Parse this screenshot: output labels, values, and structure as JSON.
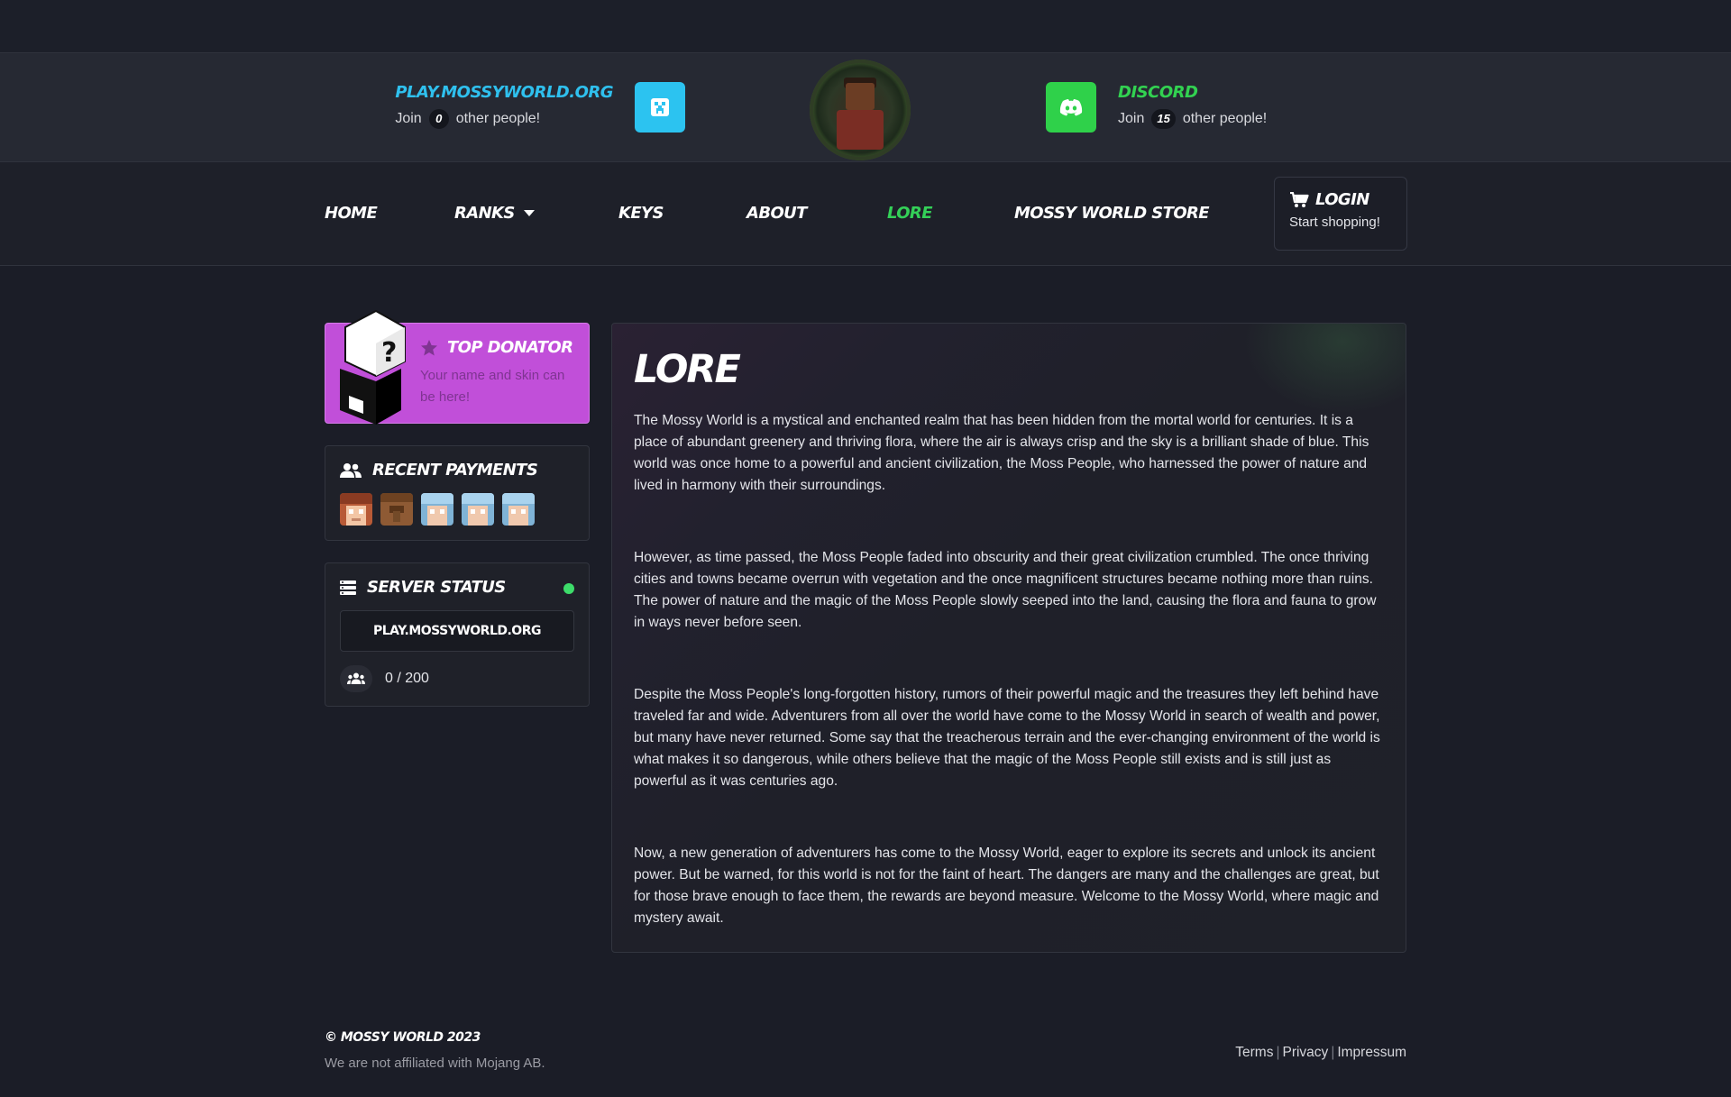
{
  "header": {
    "server_ip": "PLAY.MOSSYWORLD.ORG",
    "join_prefix": "Join",
    "join_suffix": "other people!",
    "server_players_count": "0",
    "discord_label": "DISCORD",
    "discord_members_count": "15"
  },
  "nav": {
    "items": [
      {
        "label": "HOME"
      },
      {
        "label": "RANKS"
      },
      {
        "label": "KEYS"
      },
      {
        "label": "ABOUT"
      },
      {
        "label": "LORE"
      },
      {
        "label": "MOSSY WORLD STORE"
      }
    ],
    "active": "LORE",
    "login_title": "LOGIN",
    "login_sub": "Start shopping!"
  },
  "sidebar": {
    "top_donator": {
      "title": "TOP DONATOR",
      "subtitle": "Your name and skin can be here!"
    },
    "recent_payments": {
      "title": "RECENT PAYMENTS",
      "avatars": [
        "red-hair-skin",
        "brown-villager-skin",
        "blue-hair-skin",
        "blue-hair-skin",
        "blue-hair-skin"
      ]
    },
    "server_status": {
      "title": "SERVER STATUS",
      "ip": "PLAY.MOSSYWORLD.ORG",
      "players": "0 / 200",
      "status_color": "#3ddc6a"
    }
  },
  "main": {
    "title": "LORE",
    "paragraphs": [
      "The Mossy World is a mystical and enchanted realm that has been hidden from the mortal world for centuries. It is a place of abundant greenery and thriving flora, where the air is always crisp and the sky is a brilliant shade of blue. This world was once home to a powerful and ancient civilization, the Moss People, who harnessed the power of nature and lived in harmony with their surroundings.",
      "However, as time passed, the Moss People faded into obscurity and their great civilization crumbled. The once thriving cities and towns became overrun with vegetation and the once magnificent structures became nothing more than ruins. The power of nature and the magic of the Moss People slowly seeped into the land, causing the flora and fauna to grow in ways never before seen.",
      "Despite the Moss People's long-forgotten history, rumors of their powerful magic and the treasures they left behind have traveled far and wide. Adventurers from all over the world have come to the Mossy World in search of wealth and power, but many have never returned. Some say that the treacherous terrain and the ever-changing environment of the world is what makes it so dangerous, while others believe that the magic of the Moss People still exists and is still just as powerful as it was centuries ago.",
      "Now, a new generation of adventurers has come to the Mossy World, eager to explore its secrets and unlock its ancient power. But be warned, for this world is not for the faint of heart. The dangers are many and the challenges are great, but for those brave enough to face them, the rewards are beyond measure. Welcome to the Mossy World, where magic and mystery await."
    ]
  },
  "footer": {
    "copyright": "© MOSSY WORLD 2023",
    "disclaimer": "We are not affiliated with Mojang AB.",
    "links": [
      "Terms",
      "Privacy",
      "Impressum"
    ]
  },
  "colors": {
    "accent_blue": "#2fc0ee",
    "accent_green": "#32d251",
    "donator_purple": "#c14fd9",
    "background": "#1b1d27"
  }
}
